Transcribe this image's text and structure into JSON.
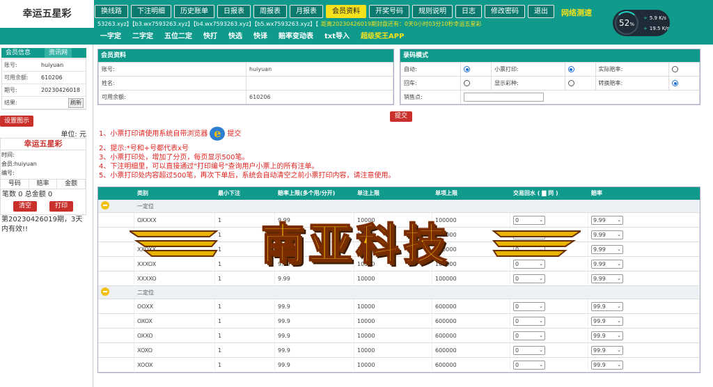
{
  "header": {
    "logo": "幸运五星彩",
    "nav": [
      {
        "label": "换线路",
        "active": false
      },
      {
        "label": "下注明细",
        "active": false
      },
      {
        "label": "历史账单",
        "active": false
      },
      {
        "label": "日报表",
        "active": false
      },
      {
        "label": "周报表",
        "active": false
      },
      {
        "label": "月报表",
        "active": false
      },
      {
        "label": "会员资料",
        "active": true
      },
      {
        "label": "开奖号码",
        "active": false
      },
      {
        "label": "规则说明",
        "active": false
      },
      {
        "label": "日志",
        "active": false
      },
      {
        "label": "修改密码",
        "active": false
      },
      {
        "label": "退出",
        "active": false
      }
    ],
    "speed_test": "网络测速",
    "gauge": {
      "percent": "52",
      "percent_unit": "%",
      "upload": "5.9",
      "download": "19.5",
      "unit": "K/s"
    },
    "domains": "53263.xyz】【b3.wx7593263.xyz】【b4.wx7593263.xyz】【b5.wx7593263.xyz】【",
    "deadline": "距离20230426019期封盘还有：0天0小时03分10秒幸运五星彩",
    "subnav": [
      "一字定",
      "二字定",
      "五位二定",
      "快打",
      "快选",
      "快译",
      "赔率变动表",
      "txt导入",
      "超级奖王APP"
    ]
  },
  "sidebar": {
    "tab_member": "会员信息",
    "tab_info": "资讯网",
    "rows": [
      {
        "k": "账号:",
        "v": "huiyuan"
      },
      {
        "k": "可用余额:",
        "v": "610206"
      },
      {
        "k": "期号:",
        "v": "20230426018"
      },
      {
        "k": "结果:",
        "v": ""
      }
    ],
    "refresh": "刷新",
    "set_button": "设置图示",
    "unit": "单位: 元",
    "ticket_title": "幸运五星彩",
    "ticket_time": "时间:",
    "ticket_member": "会员:huiyuan",
    "ticket_no": "编号:",
    "ticket_cols": [
      "号码",
      "赔率",
      "金额"
    ],
    "ticket_count": "笔数 0 总金额 0",
    "clear": "清空",
    "print": "打印",
    "notice": "第20230426019期，3天内有效!!"
  },
  "member_panel": {
    "title": "会员资料",
    "rows": [
      {
        "k": "账号:",
        "v": "huiyuan"
      },
      {
        "k": "姓名:",
        "v": ""
      },
      {
        "k": "可用余额:",
        "v": "610206"
      }
    ]
  },
  "mode_panel": {
    "title": "录码模式",
    "row1": {
      "a": "自动:",
      "b": "小票打印:",
      "c": "实际赔率:"
    },
    "row2": {
      "a": "回车:",
      "b": "显示彩种:",
      "c": "转换赔率:"
    },
    "row3": {
      "a": "销售点:"
    },
    "radios": {
      "auto": true,
      "ticket": true,
      "actual": false,
      "enter": false,
      "show": false,
      "convert": true
    }
  },
  "submit": "提交",
  "tips": [
    "1、小票打印请使用系统自带浏览器",
    "提交",
    "2、提示:*号和+号都代表x号",
    "3、小票打印处，增加了分页，每页显示500笔。",
    "4、下注明细里，可以直接通过\"打印编号\"查询用户小票上的所有注单。",
    "5、小票打印处内容超过500笔，再次下单后，系统会自动清空之前小票打印内容，请注意使用。"
  ],
  "odds_table": {
    "headers": [
      "",
      "类别",
      "最小下注",
      "赔率上限(多个用/分开)",
      "单注上限",
      "单项上限",
      "交易回水 ( ▇ 同 )",
      "赔率"
    ],
    "groups": [
      {
        "name": "一定位",
        "rows": [
          {
            "label": "OXXXX",
            "min": "1",
            "odds": "9.99",
            "single": "10000",
            "item": "100000",
            "rebate": "0",
            "rate": "9.99"
          },
          {
            "label": "XOXXX",
            "min": "1",
            "odds": "9.99",
            "single": "10000",
            "item": "100000",
            "rebate": "0",
            "rate": "9.99"
          },
          {
            "label": "XXOXX",
            "min": "1",
            "odds": "9.99",
            "single": "10000",
            "item": "100000",
            "rebate": "0",
            "rate": "9.99"
          },
          {
            "label": "XXXOX",
            "min": "1",
            "odds": "9.99",
            "single": "10000",
            "item": "100000",
            "rebate": "0",
            "rate": "9.99"
          },
          {
            "label": "XXXXO",
            "min": "1",
            "odds": "9.99",
            "single": "10000",
            "item": "100000",
            "rebate": "0",
            "rate": "9.99"
          }
        ]
      },
      {
        "name": "二定位",
        "rows": [
          {
            "label": "OOXX",
            "min": "1",
            "odds": "99.9",
            "single": "10000",
            "item": "600000",
            "rebate": "0",
            "rate": "99.9"
          },
          {
            "label": "OXOX",
            "min": "1",
            "odds": "99.9",
            "single": "10000",
            "item": "600000",
            "rebate": "0",
            "rate": "99.9"
          },
          {
            "label": "OXXO",
            "min": "1",
            "odds": "99.9",
            "single": "10000",
            "item": "600000",
            "rebate": "0",
            "rate": "99.9"
          },
          {
            "label": "XOXO",
            "min": "1",
            "odds": "99.9",
            "single": "10000",
            "item": "600000",
            "rebate": "0",
            "rate": "99.9"
          },
          {
            "label": "XOOX",
            "min": "1",
            "odds": "99.9",
            "single": "10000",
            "item": "600000",
            "rebate": "0",
            "rate": "99.9"
          }
        ]
      }
    ]
  },
  "watermark": "南亚科技",
  "colors": {
    "primary": "#0f9a8c",
    "accent": "#f5e11c",
    "danger": "#c9302c",
    "tip": "#e0241f"
  }
}
